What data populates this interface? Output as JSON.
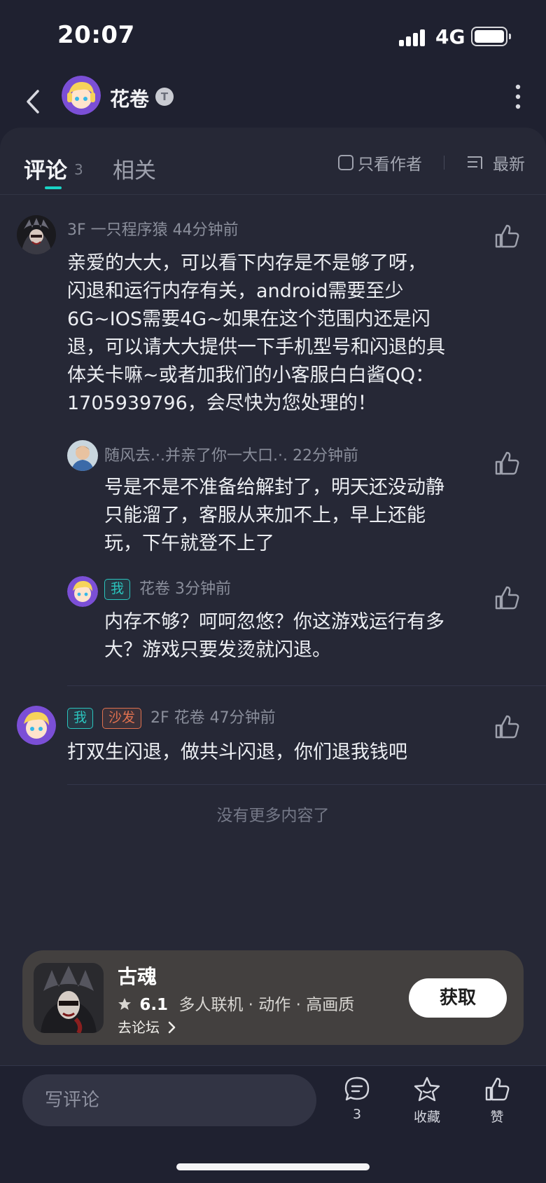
{
  "status_bar": {
    "time": "20:07",
    "network": "4G"
  },
  "header": {
    "author_name": "花卷",
    "badge": "T"
  },
  "tabs": {
    "comments_label": "评论",
    "comments_count": "3",
    "related_label": "相关",
    "author_only_label": "只看作者",
    "sort_label": "最新"
  },
  "comments": [
    {
      "meta": "3F 一只程序猿 44分钟前",
      "lines": [
        "亲爱的大大，可以看下内存是不是够了呀，",
        "闪退和运行内存有关，android需要至少",
        "6G~IOS需要4G~如果在这个范围内还是闪",
        "退，可以请大大提供一下手机型号和闪退的具",
        "体关卡嘛~或者加我们的小客服白白酱QQ：",
        "1705939796，会尽快为您处理的！"
      ],
      "replies": [
        {
          "meta": "随风去.·.并亲了你一大口.·. 22分钟前",
          "lines": [
            "号是不是不准备给解封了，明天还没动静",
            "只能溜了，客服从来加不上，早上还能",
            "玩，下午就登不上了"
          ]
        },
        {
          "tag_me": "我",
          "meta": "花卷 3分钟前",
          "lines": [
            "内存不够？呵呵忽悠？你这游戏运行有多",
            "大？游戏只要发烫就闪退。"
          ]
        }
      ]
    },
    {
      "tag_me": "我",
      "tag_sofa": "沙发",
      "meta": "2F 花卷 47分钟前",
      "lines": [
        "打双生闪退，做共斗闪退，你们退我钱吧"
      ]
    }
  ],
  "no_more": "没有更多内容了",
  "game_card": {
    "title": "古魂",
    "rating": "6.1",
    "tags": "多人联机 · 动作 · 高画质",
    "forum_link": "去论坛",
    "get_button": "获取"
  },
  "bottom_bar": {
    "input_placeholder": "写评论",
    "comment_count": "3",
    "favorite_label": "收藏",
    "like_label": "赞"
  },
  "colors": {
    "accent": "#19d3c5",
    "background": "#1f2130",
    "sheet": "#262836"
  }
}
